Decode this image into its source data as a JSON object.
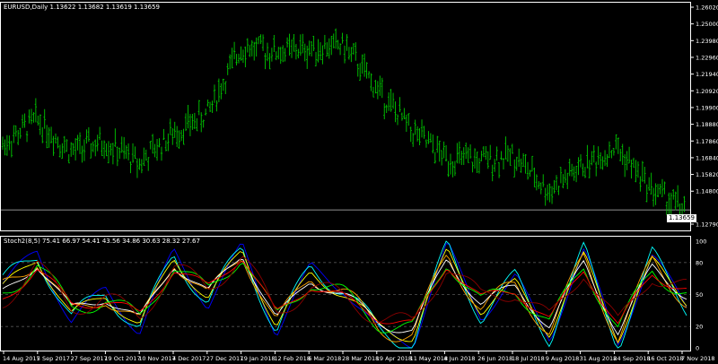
{
  "chart_title": "EURUSD,Daily  1.13622 1.13682 1.13619 1.13659",
  "indicator_title": "Stoch2(8,5) 75.41 66.97 54.41 43.56 34.86 30.63 28.32 27.67",
  "current_price": "1.13659",
  "price_axis_ticks": [
    "1.26020",
    "1.25000",
    "1.23980",
    "1.22960",
    "1.21940",
    "1.20920",
    "1.19900",
    "1.18880",
    "1.17860",
    "1.16840",
    "1.15820",
    "1.14800",
    "1.12790"
  ],
  "indicator_axis_ticks": [
    "100",
    "80",
    "50",
    "20",
    "0"
  ],
  "date_ticks": [
    "14 Aug 2017",
    "5 Sep 2017",
    "27 Sep 2017",
    "19 Oct 2017",
    "10 Nov 2017",
    "4 Dec 2017",
    "27 Dec 2017",
    "19 Jan 2018",
    "12 Feb 2018",
    "6 Mar 2018",
    "28 Mar 2018",
    "19 Apr 2018",
    "11 May 2018",
    "4 Jun 2018",
    "26 Jun 2018",
    "18 Jul 2018",
    "9 Aug 2018",
    "31 Aug 2018",
    "24 Sep 2018",
    "16 Oct 2018",
    "7 Nov 2018"
  ],
  "colors": {
    "background": "#000000",
    "candles": "#00c800",
    "axis": "#ffffff",
    "grid": "#555555",
    "stoch_lines": [
      "#0000ff",
      "#00ffff",
      "#ffff00",
      "#ffa500",
      "#ffffff",
      "#00ff00",
      "#ff0000",
      "#8b0000"
    ]
  },
  "chart_data": [
    {
      "type": "line",
      "ylim": [
        1.1279,
        1.2602
      ],
      "x": [
        "14 Aug 2017",
        "5 Sep 2017",
        "27 Sep 2017",
        "19 Oct 2017",
        "10 Nov 2017",
        "4 Dec 2017",
        "27 Dec 2017",
        "19 Jan 2018",
        "12 Feb 2018",
        "6 Mar 2018",
        "28 Mar 2018",
        "19 Apr 2018",
        "11 May 2018",
        "4 Jun 2018",
        "26 Jun 2018",
        "18 Jul 2018",
        "9 Aug 2018",
        "31 Aug 2018",
        "24 Sep 2018",
        "16 Oct 2018",
        "7 Nov 2018"
      ],
      "series": [
        {
          "values": [
            1.176,
            1.192,
            1.172,
            1.178,
            1.165,
            1.183,
            1.195,
            1.236,
            1.233,
            1.235,
            1.237,
            1.21,
            1.185,
            1.168,
            1.166,
            1.17,
            1.148,
            1.163,
            1.175,
            1.15,
            1.137
          ]
        }
      ]
    },
    {
      "type": "line",
      "ylim": [
        0,
        100
      ],
      "x": [
        "14 Aug 2017",
        "5 Sep 2017",
        "27 Sep 2017",
        "19 Oct 2017",
        "10 Nov 2017",
        "4 Dec 2017",
        "27 Dec 2017",
        "19 Jan 2018",
        "12 Feb 2018",
        "6 Mar 2018",
        "28 Mar 2018",
        "19 Apr 2018",
        "11 May 2018",
        "4 Jun 2018",
        "26 Jun 2018",
        "18 Jul 2018",
        "9 Aug 2018",
        "31 Aug 2018",
        "24 Sep 2018",
        "16 Oct 2018",
        "7 Nov 2018"
      ],
      "series": [
        {
          "values": [
            60,
            90,
            25,
            55,
            15,
            90,
            40,
            95,
            15,
            75,
            55,
            15,
            5,
            95,
            30,
            65,
            10,
            90,
            5,
            85,
            40
          ]
        },
        {
          "values": [
            55,
            85,
            30,
            50,
            20,
            85,
            45,
            92,
            20,
            70,
            50,
            20,
            10,
            90,
            35,
            60,
            15,
            85,
            10,
            80,
            45
          ]
        },
        {
          "values": [
            50,
            80,
            35,
            48,
            25,
            80,
            50,
            90,
            25,
            65,
            48,
            25,
            15,
            85,
            40,
            58,
            20,
            80,
            15,
            75,
            50
          ]
        },
        {
          "values": [
            45,
            75,
            40,
            45,
            30,
            75,
            55,
            88,
            30,
            60,
            45,
            30,
            20,
            80,
            45,
            55,
            25,
            75,
            20,
            70,
            55
          ]
        }
      ]
    }
  ]
}
